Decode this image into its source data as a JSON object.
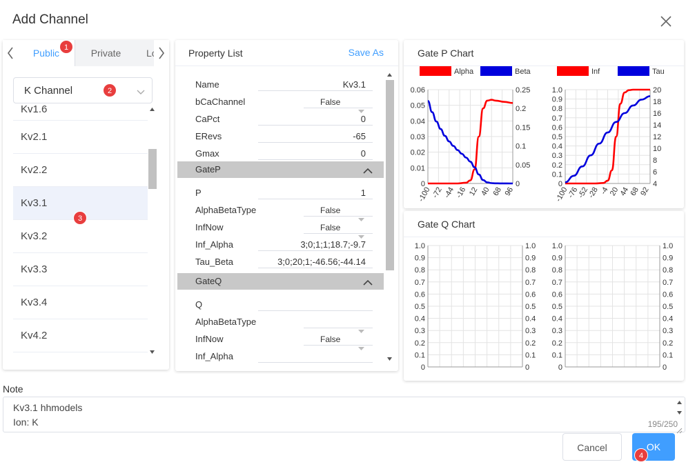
{
  "dialog": {
    "title": "Add Channel"
  },
  "tabs": {
    "items": [
      {
        "label": "Public"
      },
      {
        "label": "Private"
      },
      {
        "label": "Lo"
      }
    ]
  },
  "category_select": {
    "value": "K Channel"
  },
  "channels": {
    "items": [
      "Kv1.6",
      "Kv2.1",
      "Kv2.2",
      "Kv3.1",
      "Kv3.2",
      "Kv3.3",
      "Kv3.4",
      "Kv4.2"
    ],
    "selected": "Kv3.1"
  },
  "badges": [
    "1",
    "2",
    "3",
    "4"
  ],
  "property_list": {
    "title": "Property List",
    "save_as": "Save As",
    "rows": {
      "name": {
        "label": "Name",
        "value": "Kv3.1"
      },
      "bcachannel": {
        "label": "bCaChannel",
        "value": "False"
      },
      "capct": {
        "label": "CaPct",
        "value": "0"
      },
      "erevs": {
        "label": "ERevs",
        "value": "-65"
      },
      "gmax": {
        "label": "Gmax",
        "value": "0"
      }
    },
    "gatep": {
      "label": "GateP",
      "p": {
        "label": "P",
        "value": "1"
      },
      "alphabetatype": {
        "label": "AlphaBetaType",
        "value": "False"
      },
      "infnow": {
        "label": "InfNow",
        "value": "False"
      },
      "inf_alpha": {
        "label": "Inf_Alpha",
        "value": "3;0;1;1;18.7;-9.7"
      },
      "tau_beta": {
        "label": "Tau_Beta",
        "value": "3;0;20;1;-46.56;-44.14"
      }
    },
    "gateq": {
      "label": "GateQ",
      "q": {
        "label": "Q",
        "value": ""
      },
      "alphabetatype": {
        "label": "AlphaBetaType",
        "value": ""
      },
      "infnow": {
        "label": "InfNow",
        "value": "False"
      },
      "inf_alpha": {
        "label": "Inf_Alpha",
        "value": ""
      }
    }
  },
  "gate_p_chart": {
    "title": "Gate P Chart"
  },
  "gate_q_chart": {
    "title": "Gate Q Chart"
  },
  "colors": {
    "red": "#ff0000",
    "blue": "#0000dd",
    "accent": "#409eff"
  },
  "chart_data": [
    {
      "type": "line",
      "legend": "top",
      "x": [
        -100,
        -72,
        -44,
        -16,
        12,
        40,
        68,
        96
      ],
      "xlim": [
        -100,
        100
      ],
      "y_left_ticks": [
        "0",
        "0.01",
        "0.02",
        "0.03",
        "0.04",
        "0.05",
        "0.06"
      ],
      "y_right_ticks": [
        "0",
        "0.05",
        "0.1",
        "0.15",
        "0.2",
        "0.25"
      ],
      "ylim_left": [
        0,
        0.06
      ],
      "ylim_right": [
        0,
        0.25
      ],
      "series": [
        {
          "name": "Alpha",
          "color": "#ff0000",
          "axis": "left",
          "x": [
            -100,
            -30,
            -10,
            0,
            10,
            20,
            30,
            40,
            50,
            60,
            80,
            100
          ],
          "values": [
            0,
            0,
            0.0005,
            0.002,
            0.009,
            0.03,
            0.048,
            0.053,
            0.0535,
            0.053,
            0.0522,
            0.0515
          ]
        },
        {
          "name": "Beta",
          "color": "#0000dd",
          "axis": "right",
          "x": [
            -100,
            -90,
            -80,
            -70,
            -60,
            -50,
            -40,
            -30,
            -20,
            -10,
            0,
            10,
            20,
            30,
            40,
            50,
            60,
            70,
            100
          ],
          "values": [
            0.22,
            0.19,
            0.165,
            0.145,
            0.127,
            0.112,
            0.1,
            0.089,
            0.079,
            0.069,
            0.058,
            0.043,
            0.024,
            0.009,
            0.003,
            0.001,
            0.0004,
            0.0002,
            0
          ]
        }
      ],
      "grid": true
    },
    {
      "type": "line",
      "legend": "top",
      "x": [
        -100,
        -76,
        -52,
        -28,
        -4,
        20,
        44,
        68,
        92
      ],
      "xlim": [
        -100,
        100
      ],
      "y_left_ticks": [
        "0",
        "0.1",
        "0.2",
        "0.3",
        "0.4",
        "0.5",
        "0.6",
        "0.7",
        "0.8",
        "0.9",
        "1.0"
      ],
      "y_right_ticks": [
        "4",
        "6",
        "8",
        "10",
        "12",
        "14",
        "16",
        "18",
        "20"
      ],
      "ylim_left": [
        0,
        1
      ],
      "ylim_right": [
        4,
        20
      ],
      "series": [
        {
          "name": "Inf",
          "color": "#ff0000",
          "axis": "left",
          "x": [
            -100,
            -30,
            -10,
            0,
            10,
            20,
            30,
            40,
            50,
            60,
            100
          ],
          "values": [
            0,
            0,
            0.005,
            0.03,
            0.14,
            0.5,
            0.85,
            0.97,
            0.995,
            1,
            1
          ]
        },
        {
          "name": "Tau",
          "color": "#0000dd",
          "axis": "right",
          "x": [
            -100,
            -80,
            -60,
            -40,
            -20,
            0,
            20,
            40,
            60,
            80,
            100
          ],
          "values": [
            4.2,
            5.3,
            6.9,
            8.8,
            10.8,
            12.7,
            14.5,
            16.0,
            17.3,
            18.3,
            18.9
          ]
        }
      ],
      "grid": true
    },
    {
      "type": "line",
      "ylim": [
        0,
        1
      ],
      "y_left_ticks": [
        "0",
        "0.1",
        "0.2",
        "0.3",
        "0.4",
        "0.5",
        "0.6",
        "0.7",
        "0.8",
        "0.9",
        "1.0"
      ],
      "y_right_ticks": [
        "0",
        "0.1",
        "0.2",
        "0.3",
        "0.4",
        "0.5",
        "0.6",
        "0.7",
        "0.8",
        "0.9",
        "1.0"
      ],
      "series": [],
      "grid": true
    },
    {
      "type": "line",
      "ylim": [
        0,
        1
      ],
      "y_left_ticks": [
        "0",
        "0.1",
        "0.2",
        "0.3",
        "0.4",
        "0.5",
        "0.6",
        "0.7",
        "0.8",
        "0.9",
        "1.0"
      ],
      "y_right_ticks": [
        "0",
        "0.1",
        "0.2",
        "0.3",
        "0.4",
        "0.5",
        "0.6",
        "0.7",
        "0.8",
        "0.9",
        "1.0"
      ],
      "series": [],
      "grid": true
    }
  ],
  "note": {
    "label": "Note",
    "lines": [
      "Kv3.1 hhmodels",
      "Ion: K"
    ],
    "count": "195/250"
  },
  "buttons": {
    "cancel": "Cancel",
    "ok": "OK"
  }
}
